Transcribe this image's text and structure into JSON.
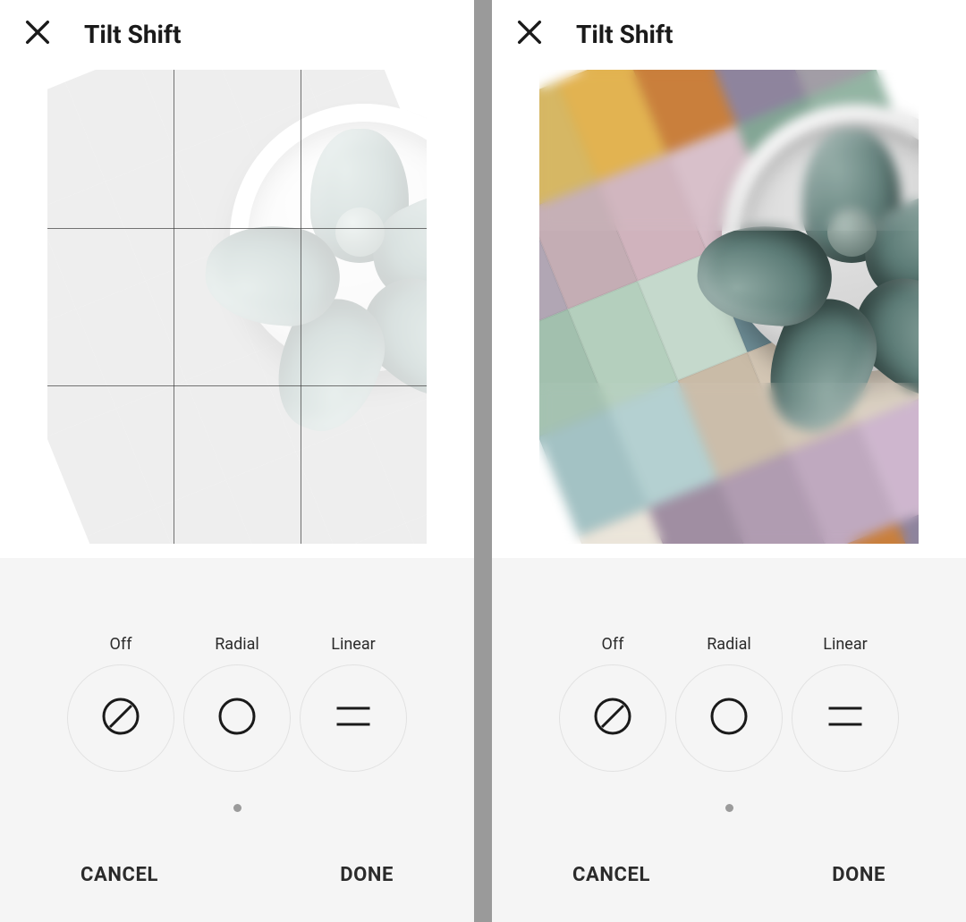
{
  "screens": {
    "left": {
      "title": "Tilt Shift",
      "show_grid": true,
      "washed_out": true,
      "show_linear_blur": false,
      "modes": [
        {
          "id": "off",
          "label": "Off",
          "icon": "off-icon"
        },
        {
          "id": "radial",
          "label": "Radial",
          "icon": "radial-icon"
        },
        {
          "id": "linear",
          "label": "Linear",
          "icon": "linear-icon"
        }
      ],
      "footer": {
        "cancel": "CANCEL",
        "done": "DONE"
      }
    },
    "right": {
      "title": "Tilt Shift",
      "show_grid": false,
      "washed_out": false,
      "show_linear_blur": true,
      "modes": [
        {
          "id": "off",
          "label": "Off",
          "icon": "off-icon"
        },
        {
          "id": "radial",
          "label": "Radial",
          "icon": "radial-icon"
        },
        {
          "id": "linear",
          "label": "Linear",
          "icon": "linear-icon"
        }
      ],
      "footer": {
        "cancel": "CANCEL",
        "done": "DONE"
      }
    }
  },
  "tile_colors": [
    "#b7967a",
    "#d5b55e",
    "#e1b04a",
    "#c77a35",
    "#8a7f9a",
    "#9f9aa3",
    "#b1a6b4",
    "#c4adb4",
    "#d0b3bd",
    "#d7bec8",
    "#7ea391",
    "#8fb2a0",
    "#a2c0ae",
    "#b4cfbd",
    "#c5d9cc",
    "#6f8f98",
    "#7fa0a6",
    "#8eb0b4",
    "#a0c0c2",
    "#b1cfd0",
    "#c9bba7",
    "#d3c6b4",
    "#dbd0c1",
    "#e4dbcd",
    "#ebe4d9",
    "#9d8a9f",
    "#ad98ae",
    "#bda6bd",
    "#ccb4cc",
    "#dbc4da"
  ],
  "colors": {
    "background": "#ffffff",
    "controls_bg": "#f5f5f5",
    "divider": "#9a9a9a",
    "circle_border": "#e2e2e2",
    "text": "#2b2b2b"
  }
}
